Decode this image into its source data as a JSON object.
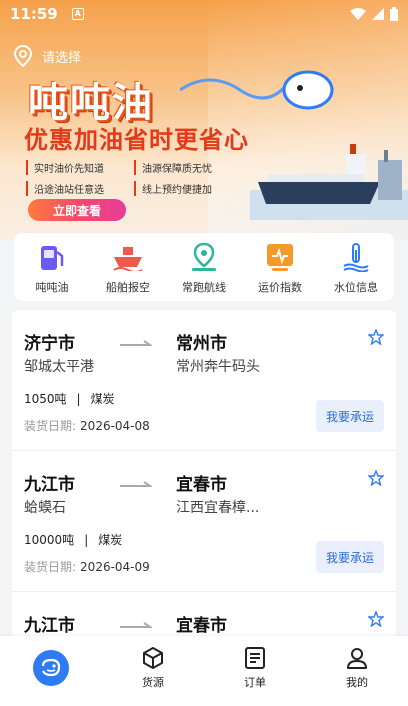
{
  "status": {
    "time": "11:59",
    "badge": "A"
  },
  "location": {
    "placeholder": "请选择"
  },
  "banner": {
    "brand": "吨吨油",
    "slogan": "优惠加油省时更省心",
    "features": [
      "实时油价先知道",
      "油源保障质无忧",
      "沿途油站任意选",
      "线上预约便捷加"
    ],
    "cta": "立即查看"
  },
  "menu": {
    "items": [
      {
        "label": "吨吨油",
        "icon": "fuel-pump-icon"
      },
      {
        "label": "船舶报空",
        "icon": "ship-icon"
      },
      {
        "label": "常跑航线",
        "icon": "route-pin-icon"
      },
      {
        "label": "运价指数",
        "icon": "chart-index-icon"
      },
      {
        "label": "水位信息",
        "icon": "water-level-icon"
      }
    ]
  },
  "orders": [
    {
      "from_city": "济宁市",
      "from_port": "邹城太平港",
      "to_city": "常州市",
      "to_port": "常州奔牛码头",
      "tonnage": "1050吨",
      "cargo": "煤炭",
      "date_label": "装货日期:",
      "date": "2026-04-08",
      "action": "我要承运"
    },
    {
      "from_city": "九江市",
      "from_port": "蛤蟆石",
      "to_city": "宜春市",
      "to_port": "江西宜春樟...",
      "tonnage": "10000吨",
      "cargo": "煤炭",
      "date_label": "装货日期:",
      "date": "2026-04-09",
      "action": "我要承运"
    },
    {
      "from_city": "九江市",
      "from_port": "",
      "to_city": "宜春市",
      "to_port": "",
      "tonnage": "",
      "cargo": "",
      "date_label": "",
      "date": "",
      "action": ""
    }
  ],
  "tabbar": {
    "items": [
      {
        "label": "",
        "icon": "home-whale-icon"
      },
      {
        "label": "货源",
        "icon": "cube-icon"
      },
      {
        "label": "订单",
        "icon": "document-icon"
      },
      {
        "label": "我的",
        "icon": "user-icon"
      }
    ]
  },
  "colors": {
    "accent": "#2d7cf6",
    "brand_orange": "#f6a14a",
    "slogan_red": "#e23a1a"
  }
}
